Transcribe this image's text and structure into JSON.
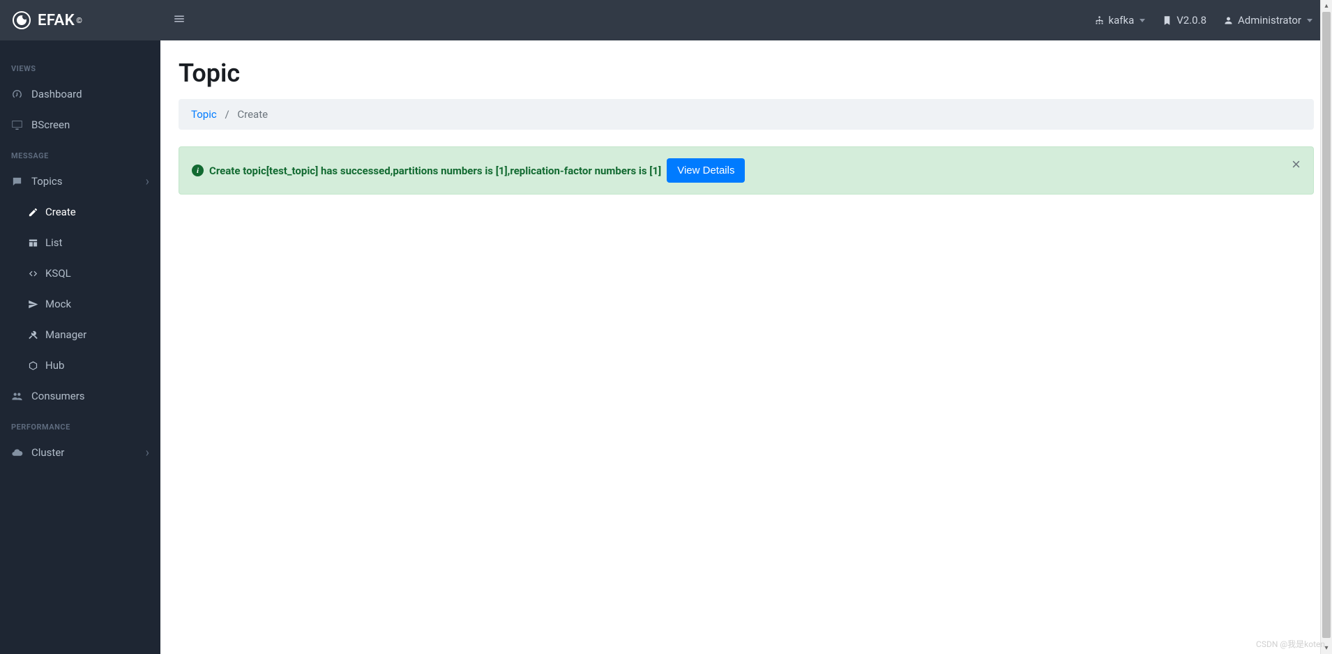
{
  "brand": {
    "name": "EFAK",
    "copy": "©"
  },
  "topbar": {
    "cluster": "kafka",
    "version": "V2.0.8",
    "user": "Administrator"
  },
  "sidebar": {
    "sections": [
      {
        "title": "VIEWS",
        "items": [
          {
            "label": "Dashboard",
            "icon": "dashboard"
          },
          {
            "label": "BScreen",
            "icon": "monitor"
          }
        ]
      },
      {
        "title": "MESSAGE",
        "items": [
          {
            "label": "Topics",
            "icon": "comment",
            "chevron": true,
            "children": [
              {
                "label": "Create",
                "icon": "edit",
                "active": true
              },
              {
                "label": "List",
                "icon": "table"
              },
              {
                "label": "KSQL",
                "icon": "code"
              },
              {
                "label": "Mock",
                "icon": "send"
              },
              {
                "label": "Manager",
                "icon": "tools"
              },
              {
                "label": "Hub",
                "icon": "cube"
              }
            ]
          },
          {
            "label": "Consumers",
            "icon": "users"
          }
        ]
      },
      {
        "title": "PERFORMANCE",
        "items": [
          {
            "label": "Cluster",
            "icon": "cloud",
            "chevron": true
          }
        ]
      }
    ]
  },
  "page": {
    "title": "Topic",
    "breadcrumb": {
      "parent": "Topic",
      "current": "Create"
    }
  },
  "alert": {
    "message": "Create topic[test_topic] has successed,partitions numbers is [1],replication-factor numbers is [1]",
    "button": "View Details"
  },
  "watermark": "CSDN @我是koten"
}
